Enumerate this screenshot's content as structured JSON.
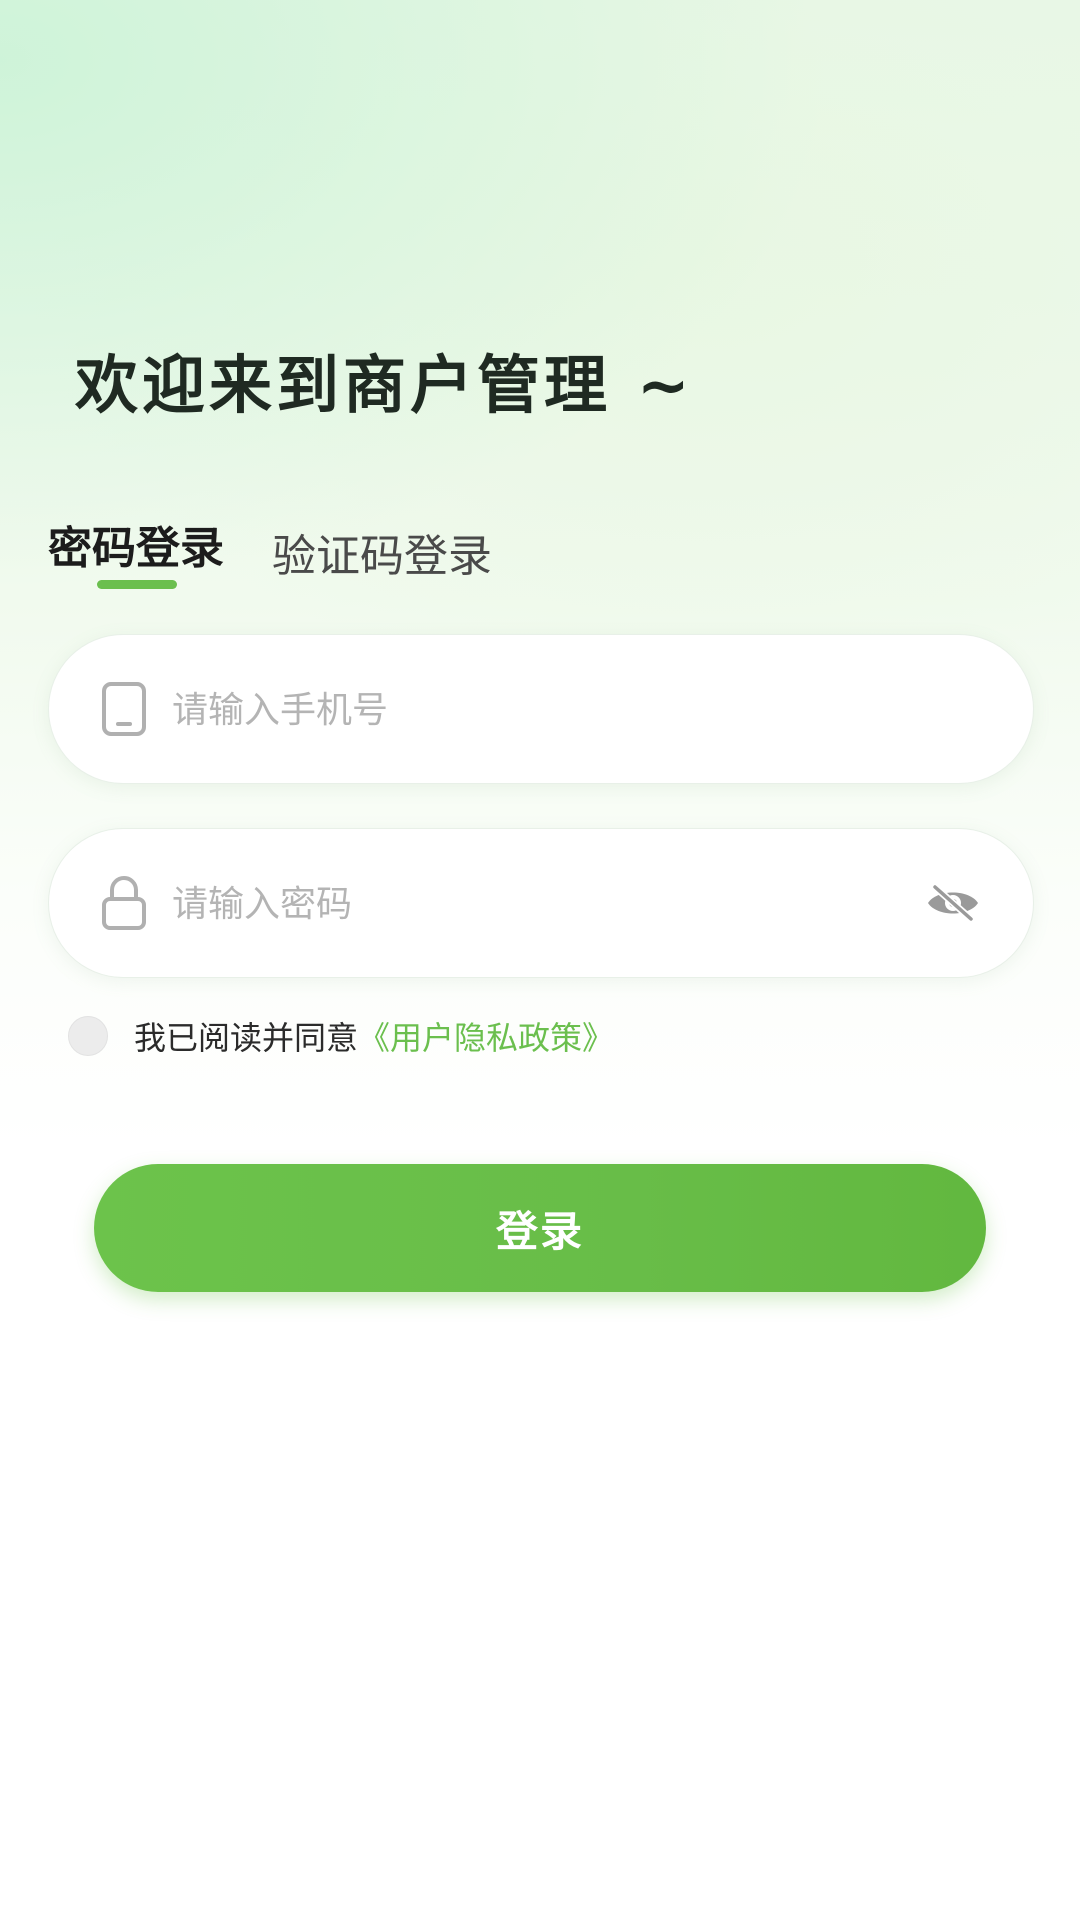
{
  "header": {
    "welcome_title": "欢迎来到商户管理 ~"
  },
  "tabs": {
    "password_login": "密码登录",
    "code_login": "验证码登录",
    "active": "password_login"
  },
  "form": {
    "phone": {
      "placeholder": "请输入手机号",
      "value": "",
      "icon": "phone-icon"
    },
    "password": {
      "placeholder": "请输入密码",
      "value": "",
      "icon": "lock-icon",
      "toggle_icon": "eye-hidden-icon"
    }
  },
  "agreement": {
    "checked": false,
    "text": "我已阅读并同意",
    "policy_link": "《用户隐私政策》"
  },
  "actions": {
    "login_label": "登录"
  },
  "colors": {
    "accent": "#6bbf4e",
    "button": "#68bd48",
    "title": "#1f2a22",
    "placeholder": "#b4b4b4"
  }
}
